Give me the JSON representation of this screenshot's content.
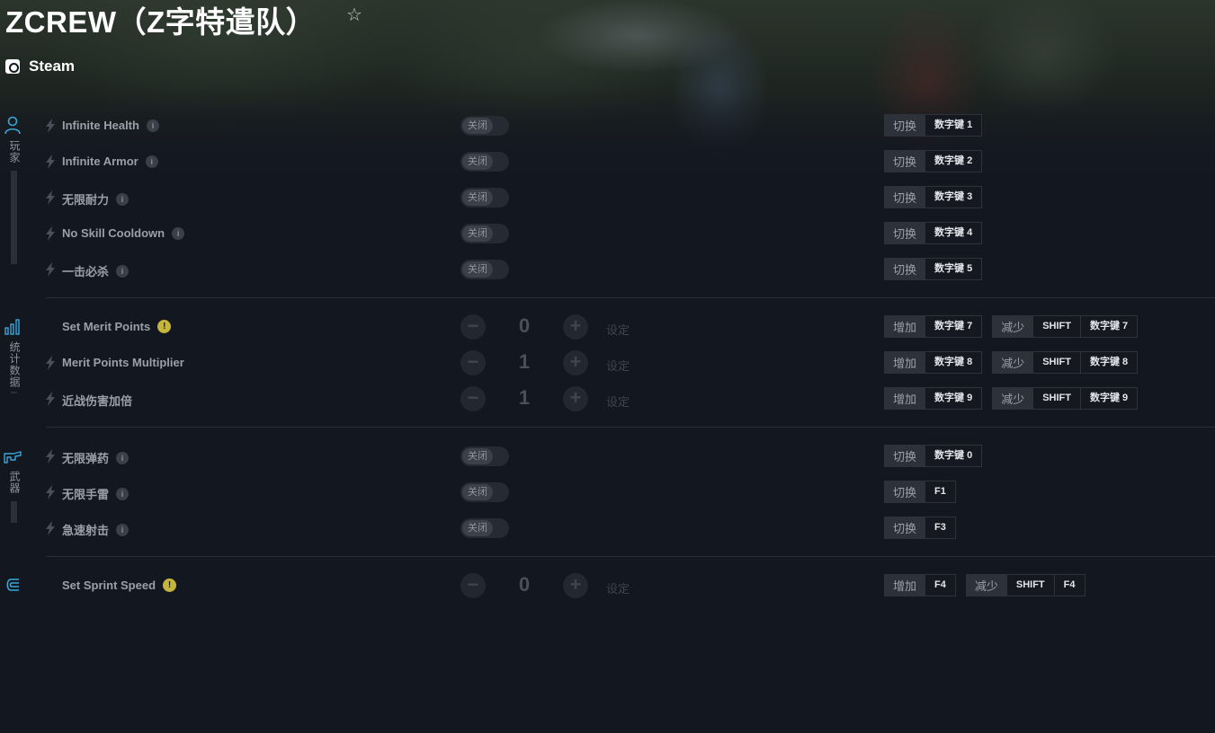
{
  "header": {
    "title": "ZCREW（Z字特遣队）",
    "favorite_icon": "star-icon",
    "platform": "Steam"
  },
  "sidebar": [
    {
      "icon": "player-icon",
      "label": "玩家"
    },
    {
      "icon": "stats-icon",
      "label": "统计数据"
    },
    {
      "icon": "weapon-icon",
      "label": "武器"
    },
    {
      "icon": "movement-icon",
      "label": ""
    }
  ],
  "toggle_label": "关闭",
  "apply_label": "设定",
  "cheats": [
    {
      "name": "Infinite Health",
      "type": "toggle",
      "keys": [
        {
          "action": "切换",
          "caps": [
            "数字键 1"
          ]
        }
      ]
    },
    {
      "name": "Infinite Armor",
      "type": "toggle",
      "keys": [
        {
          "action": "切换",
          "caps": [
            "数字键 2"
          ]
        }
      ]
    },
    {
      "name": "无限耐力",
      "type": "toggle",
      "keys": [
        {
          "action": "切换",
          "caps": [
            "数字键 3"
          ]
        }
      ]
    },
    {
      "name": "No Skill Cooldown",
      "type": "toggle",
      "keys": [
        {
          "action": "切换",
          "caps": [
            "数字键 4"
          ]
        }
      ]
    },
    {
      "name": "一击必杀",
      "type": "toggle",
      "keys": [
        {
          "action": "切换",
          "caps": [
            "数字键 5"
          ]
        }
      ]
    },
    {
      "name": "Set Merit Points",
      "type": "stepper",
      "value": "0",
      "keys": [
        {
          "action": "增加",
          "caps": [
            "数字键 7"
          ]
        },
        {
          "action": "减少",
          "caps": [
            "SHIFT",
            "数字键 7"
          ]
        }
      ]
    },
    {
      "name": "Merit Points Multiplier",
      "type": "stepper",
      "value": "1",
      "keys": [
        {
          "action": "增加",
          "caps": [
            "数字键 8"
          ]
        },
        {
          "action": "减少",
          "caps": [
            "SHIFT",
            "数字键 8"
          ]
        }
      ]
    },
    {
      "name": "近战伤害加倍",
      "type": "stepper",
      "value": "1",
      "keys": [
        {
          "action": "增加",
          "caps": [
            "数字键 9"
          ]
        },
        {
          "action": "减少",
          "caps": [
            "SHIFT",
            "数字键 9"
          ]
        }
      ]
    },
    {
      "name": "无限弹药",
      "type": "toggle",
      "keys": [
        {
          "action": "切换",
          "caps": [
            "数字键 0"
          ]
        }
      ]
    },
    {
      "name": "无限手雷",
      "type": "toggle",
      "keys": [
        {
          "action": "切换",
          "caps": [
            "F1"
          ]
        }
      ]
    },
    {
      "name": "急速射击",
      "type": "toggle",
      "keys": [
        {
          "action": "切换",
          "caps": [
            "F3"
          ]
        }
      ]
    },
    {
      "name": "Set Sprint Speed",
      "type": "stepper",
      "value": "0",
      "keys": [
        {
          "action": "增加",
          "caps": [
            "F4"
          ]
        },
        {
          "action": "减少",
          "caps": [
            "SHIFT",
            "F4"
          ]
        }
      ]
    }
  ]
}
